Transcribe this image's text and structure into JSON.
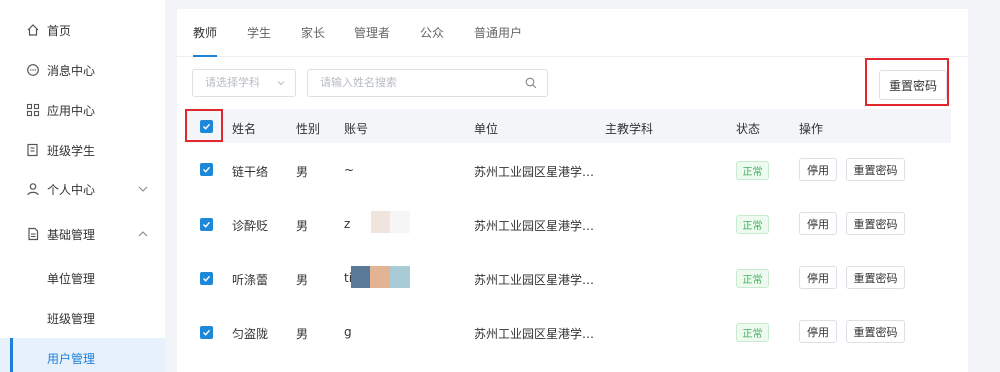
{
  "sidebar": {
    "items": [
      {
        "label": "首页",
        "icon": "home-icon"
      },
      {
        "label": "消息中心",
        "icon": "message-icon"
      },
      {
        "label": "应用中心",
        "icon": "apps-grid-icon"
      },
      {
        "label": "班级学生",
        "icon": "class-book-icon"
      },
      {
        "label": "个人中心",
        "icon": "user-icon"
      },
      {
        "label": "基础管理",
        "icon": "document-icon"
      }
    ],
    "sub_items": [
      {
        "label": "单位管理"
      },
      {
        "label": "班级管理"
      },
      {
        "label": "用户管理"
      }
    ]
  },
  "tabs": [
    "教师",
    "学生",
    "家长",
    "管理者",
    "公众",
    "普通用户"
  ],
  "filters": {
    "subject_placeholder": "请选择学科",
    "search_placeholder": "请输入姓名搜索"
  },
  "toolbar": {
    "reset_password_label": "重置密码"
  },
  "table": {
    "headers": [
      "姓名",
      "性别",
      "账号",
      "单位",
      "主教学科",
      "状态",
      "操作"
    ],
    "rows": [
      {
        "name": "链干络",
        "gender": "男",
        "account": "~",
        "unit": "苏州工业园区星港学…",
        "subject": "",
        "status": "正常"
      },
      {
        "name": "诊酔贬",
        "gender": "男",
        "account": "z",
        "unit": "苏州工业园区星港学…",
        "subject": "",
        "status": "正常"
      },
      {
        "name": "听涤蕾",
        "gender": "男",
        "account": "ti",
        "unit": "苏州工业园区星港学…",
        "subject": "",
        "status": "正常"
      },
      {
        "name": "匀盗陇",
        "gender": "男",
        "account": "g",
        "unit": "苏州工业园区星港学…",
        "subject": "",
        "status": "正常"
      }
    ],
    "actions": {
      "disable_label": "停用",
      "reset_label": "重置密码"
    }
  },
  "colors": {
    "accent": "#1e7fd9",
    "highlight": "#e0282e",
    "status_green": "#3fb25c",
    "active_bg": "#e6f1fc"
  }
}
